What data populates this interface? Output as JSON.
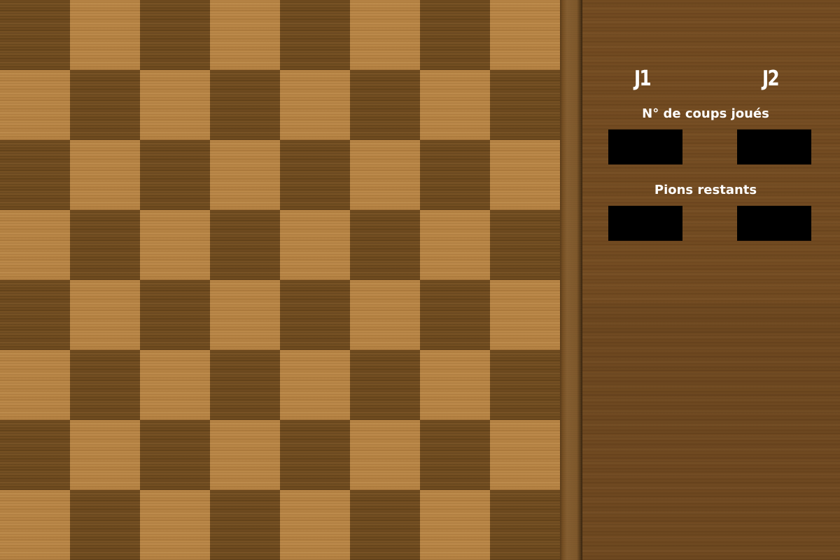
{
  "board": {
    "size": 8,
    "top_left_color": "dark",
    "colors": {
      "light_square": "#b78342",
      "dark_square": "#6f4a1d"
    }
  },
  "panel": {
    "players": {
      "j1_label": "J1",
      "j2_label": "J2"
    },
    "moves": {
      "title": "N° de coups joués",
      "j1_value": "",
      "j2_value": ""
    },
    "pawns": {
      "title": "Pions restants",
      "j1_value": "",
      "j2_value": ""
    },
    "colors": {
      "panel_background": "#71491f",
      "text": "#ffffff",
      "value_box": "#000000"
    }
  }
}
